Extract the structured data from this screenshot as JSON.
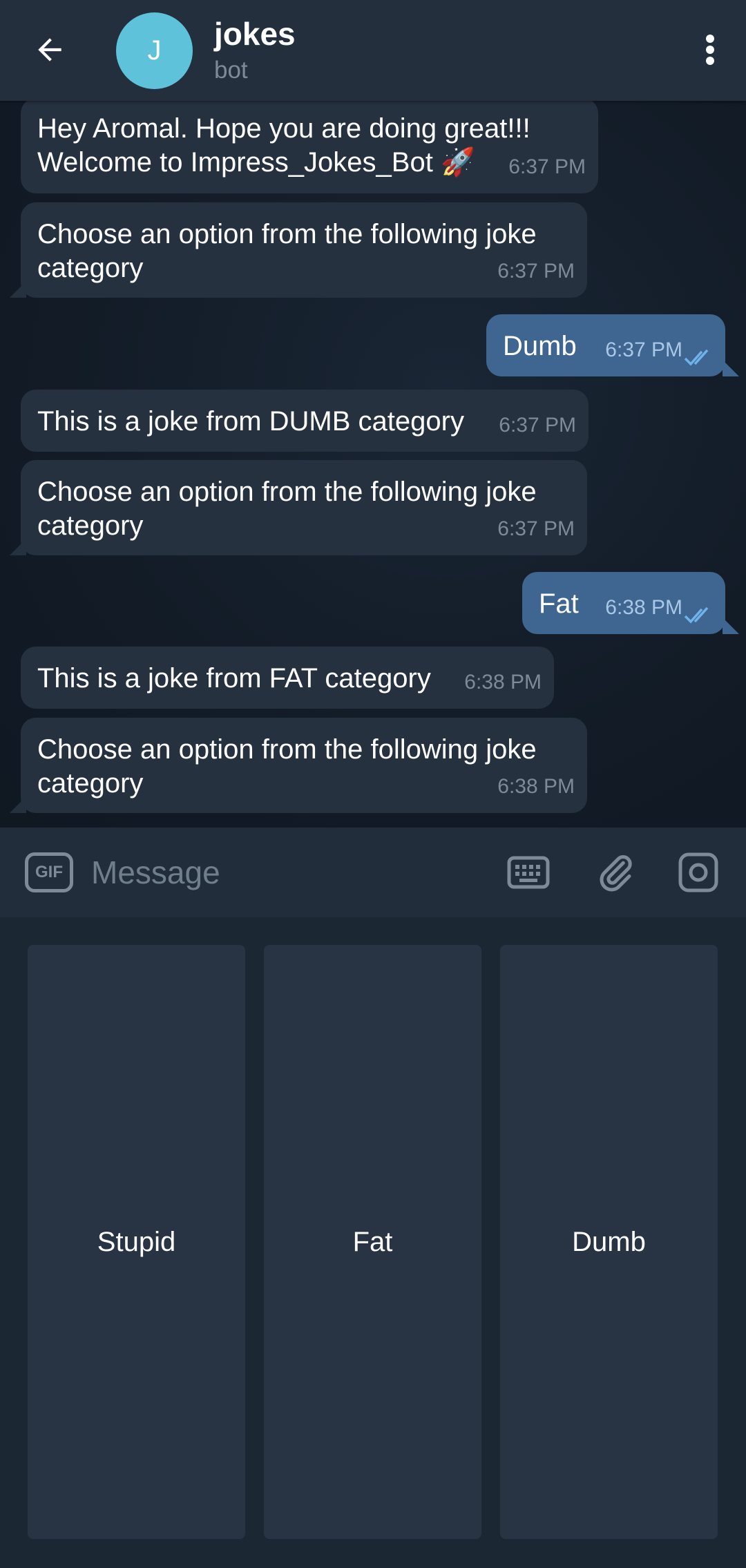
{
  "header": {
    "back_icon": "arrow-left-icon",
    "avatar_letter": "J",
    "avatar_color": "#5ec2db",
    "title": "jokes",
    "subtitle": "bot",
    "menu_icon": "more-vertical-icon"
  },
  "messages": [
    {
      "direction": "in",
      "text": "Hey Aromal. Hope you are doing great!!! Welcome to Impress_Jokes_Bot 🚀",
      "time": "6:37 PM"
    },
    {
      "direction": "in",
      "text": "Choose an option from the following joke category",
      "time": "6:37 PM"
    },
    {
      "direction": "out",
      "text": "Dumb",
      "time": "6:37 PM",
      "status": "read"
    },
    {
      "direction": "in",
      "text": "This is a joke from DUMB category",
      "time": "6:37 PM"
    },
    {
      "direction": "in",
      "text": "Choose an option from the following joke category",
      "time": "6:37 PM"
    },
    {
      "direction": "out",
      "text": "Fat",
      "time": "6:38 PM",
      "status": "read"
    },
    {
      "direction": "in",
      "text": "This is a joke from FAT category",
      "time": "6:38 PM"
    },
    {
      "direction": "in",
      "text": "Choose an option from the following joke category",
      "time": "6:38 PM"
    }
  ],
  "input": {
    "gif_label": "GIF",
    "placeholder": "Message",
    "keyboard_icon": "keyboard-icon",
    "attach_icon": "paperclip-icon",
    "camera_icon": "camera-icon"
  },
  "bot_keyboard": {
    "buttons": [
      "Stupid",
      "Fat",
      "Dumb"
    ]
  },
  "colors": {
    "header_bg": "#232f3c",
    "incoming_bubble": "#263140",
    "outgoing_bubble": "#3f6690",
    "read_ticks": "#6fb3ea"
  }
}
